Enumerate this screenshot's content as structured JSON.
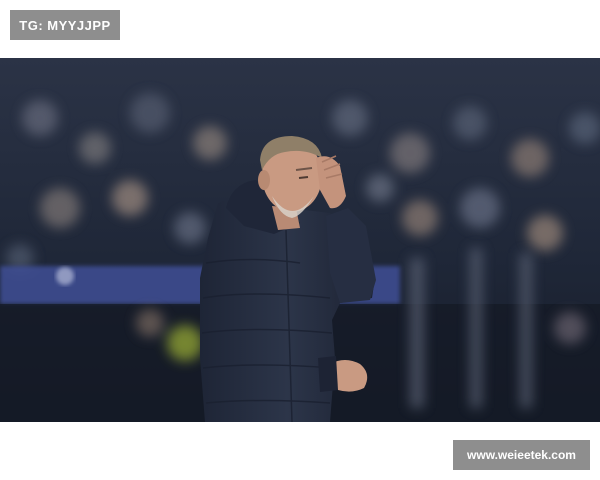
{
  "top_badge": {
    "text": "TG: MYYJJPP"
  },
  "bottom_badge": {
    "text": "www.weieetek.com"
  },
  "photo": {
    "subject": "man-in-navy-padded-jacket-hand-on-head",
    "background": "blurred-stadium-crowd-at-night",
    "colors": {
      "crowd_dark": "#1d2433",
      "crowd_mid": "#3a4356",
      "jacket": "#2a3246",
      "skin": "#c99a82",
      "hair": "#8a7a66",
      "barrier": "#4a5ca8"
    }
  }
}
